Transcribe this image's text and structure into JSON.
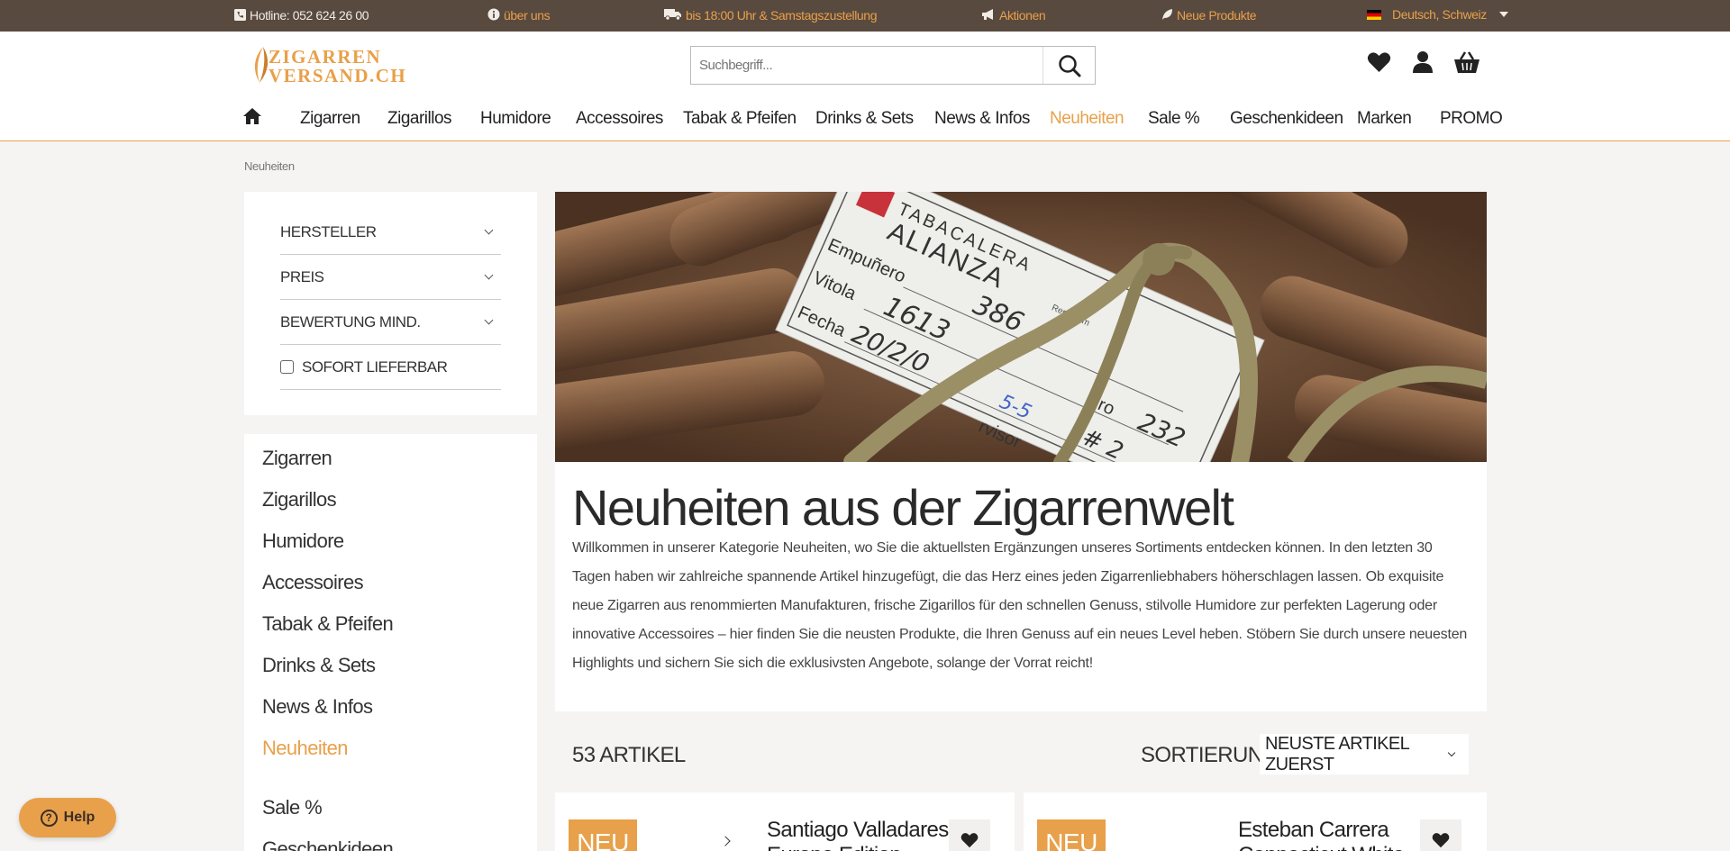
{
  "topbar": {
    "hotline": "Hotline: 052 624 26 00",
    "about": "über uns",
    "delivery": "bis 18:00 Uhr & Samstagszustellung",
    "actions": "Aktionen",
    "new_products": "Neue Produkte",
    "language": "Deutsch, Schweiz"
  },
  "header": {
    "logo_line1": "ZIGARREN",
    "logo_line2": "VERSAND.CH",
    "search_placeholder": "Suchbegriff..."
  },
  "nav": [
    "Zigarren",
    "Zigarillos",
    "Humidore",
    "Accessoires",
    "Tabak & Pfeifen",
    "Drinks & Sets",
    "News & Infos",
    "Neuheiten",
    "Sale %",
    "Geschenkideen",
    "Marken",
    "PROMO"
  ],
  "breadcrumb": "Neuheiten",
  "filters": {
    "manufacturer": "HERSTELLER",
    "price": "PREIS",
    "rating": "BEWERTUNG MIND.",
    "instant": "SOFORT LIEFERBAR"
  },
  "categories": [
    "Zigarren",
    "Zigarillos",
    "Humidore",
    "Accessoires",
    "Tabak & Pfeifen",
    "Drinks & Sets",
    "News & Infos",
    "Neuheiten",
    "Sale %",
    "Geschenkideen"
  ],
  "hero": {
    "tag_brand": "TABACALERA",
    "tag_name": "ALIANZA",
    "tag_f1": "Empuñero",
    "tag_f2": "Vitola",
    "tag_f3": "Fecha",
    "tag_f4": "ero",
    "tag_f5": "rvisor",
    "tag_v1": "386",
    "tag_v2": "1613",
    "tag_v3": "20/2/0",
    "tag_v4": "232",
    "tag_v5": "5-5",
    "tag_v6": "# 2",
    "tag_rep": "Rep. Dom"
  },
  "content": {
    "title": "Neuheiten aus der Zigarrenwelt",
    "text": "Willkommen in unserer Kategorie Neuheiten, wo Sie die aktuellsten Ergänzungen unseres Sortiments entdecken können. In den letzten 30 Tagen haben wir zahlreiche spannende Artikel hinzugefügt, die das Herz eines jeden Zigarrenliebhabers höherschlagen lassen. Ob exquisite neue Zigarren aus renommierten Manufakturen, frische Zigarillos für den schnellen Genuss, stilvolle Humidore zur perfekten Lagerung oder innovative Accessoires – hier finden Sie die neusten Produkte, die Ihren Genuss auf ein neues Level heben. Stöbern Sie durch unsere neuesten Highlights und sichern Sie sich die exklusivsten Angebote, solange der Vorrat reicht!"
  },
  "listing": {
    "count": "53 ARTIKEL",
    "sort_label": "SORTIERUNG",
    "sort_value": "NEUSTE ARTIKEL ZUERST"
  },
  "products": [
    {
      "badge": "NEU",
      "title1": "Santiago Valladares",
      "title2": "Europe Edition"
    },
    {
      "badge": "NEU",
      "title1": "Esteban Carrera",
      "title2": "Connecticut White"
    }
  ],
  "help": {
    "label": "Help"
  },
  "colors": {
    "accent": "#e8a04a",
    "topbar": "#594a40"
  }
}
